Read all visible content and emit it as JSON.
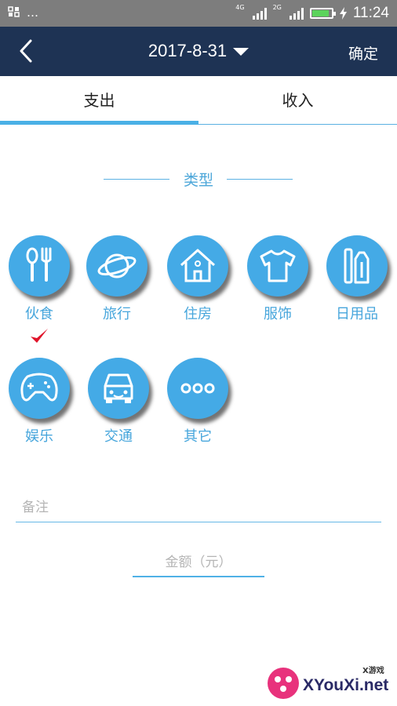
{
  "status_bar": {
    "left_text": "…",
    "net_label": "4G",
    "net_label2": "2G",
    "time": "11:24"
  },
  "header": {
    "date": "2017-8-31",
    "confirm_label": "确定"
  },
  "tabs": [
    {
      "label": "支出"
    },
    {
      "label": "收入"
    }
  ],
  "section": {
    "title": "类型"
  },
  "categories": [
    {
      "label": "伙食",
      "icon": "utensils-icon"
    },
    {
      "label": "旅行",
      "icon": "planet-icon"
    },
    {
      "label": "住房",
      "icon": "house-icon"
    },
    {
      "label": "服饰",
      "icon": "tshirt-icon"
    },
    {
      "label": "日用品",
      "icon": "toiletries-icon"
    },
    {
      "label": "娱乐",
      "icon": "gamepad-icon"
    },
    {
      "label": "交通",
      "icon": "car-icon"
    },
    {
      "label": "其它",
      "icon": "more-icon"
    }
  ],
  "form": {
    "note_placeholder": "备注",
    "amount_placeholder": "金额（元）"
  },
  "watermark": {
    "brand": "XYouXi.net",
    "small": "X游戏"
  },
  "colors": {
    "header_bg": "#1e3354",
    "accent": "#44aae6",
    "check": "#e0142a"
  }
}
